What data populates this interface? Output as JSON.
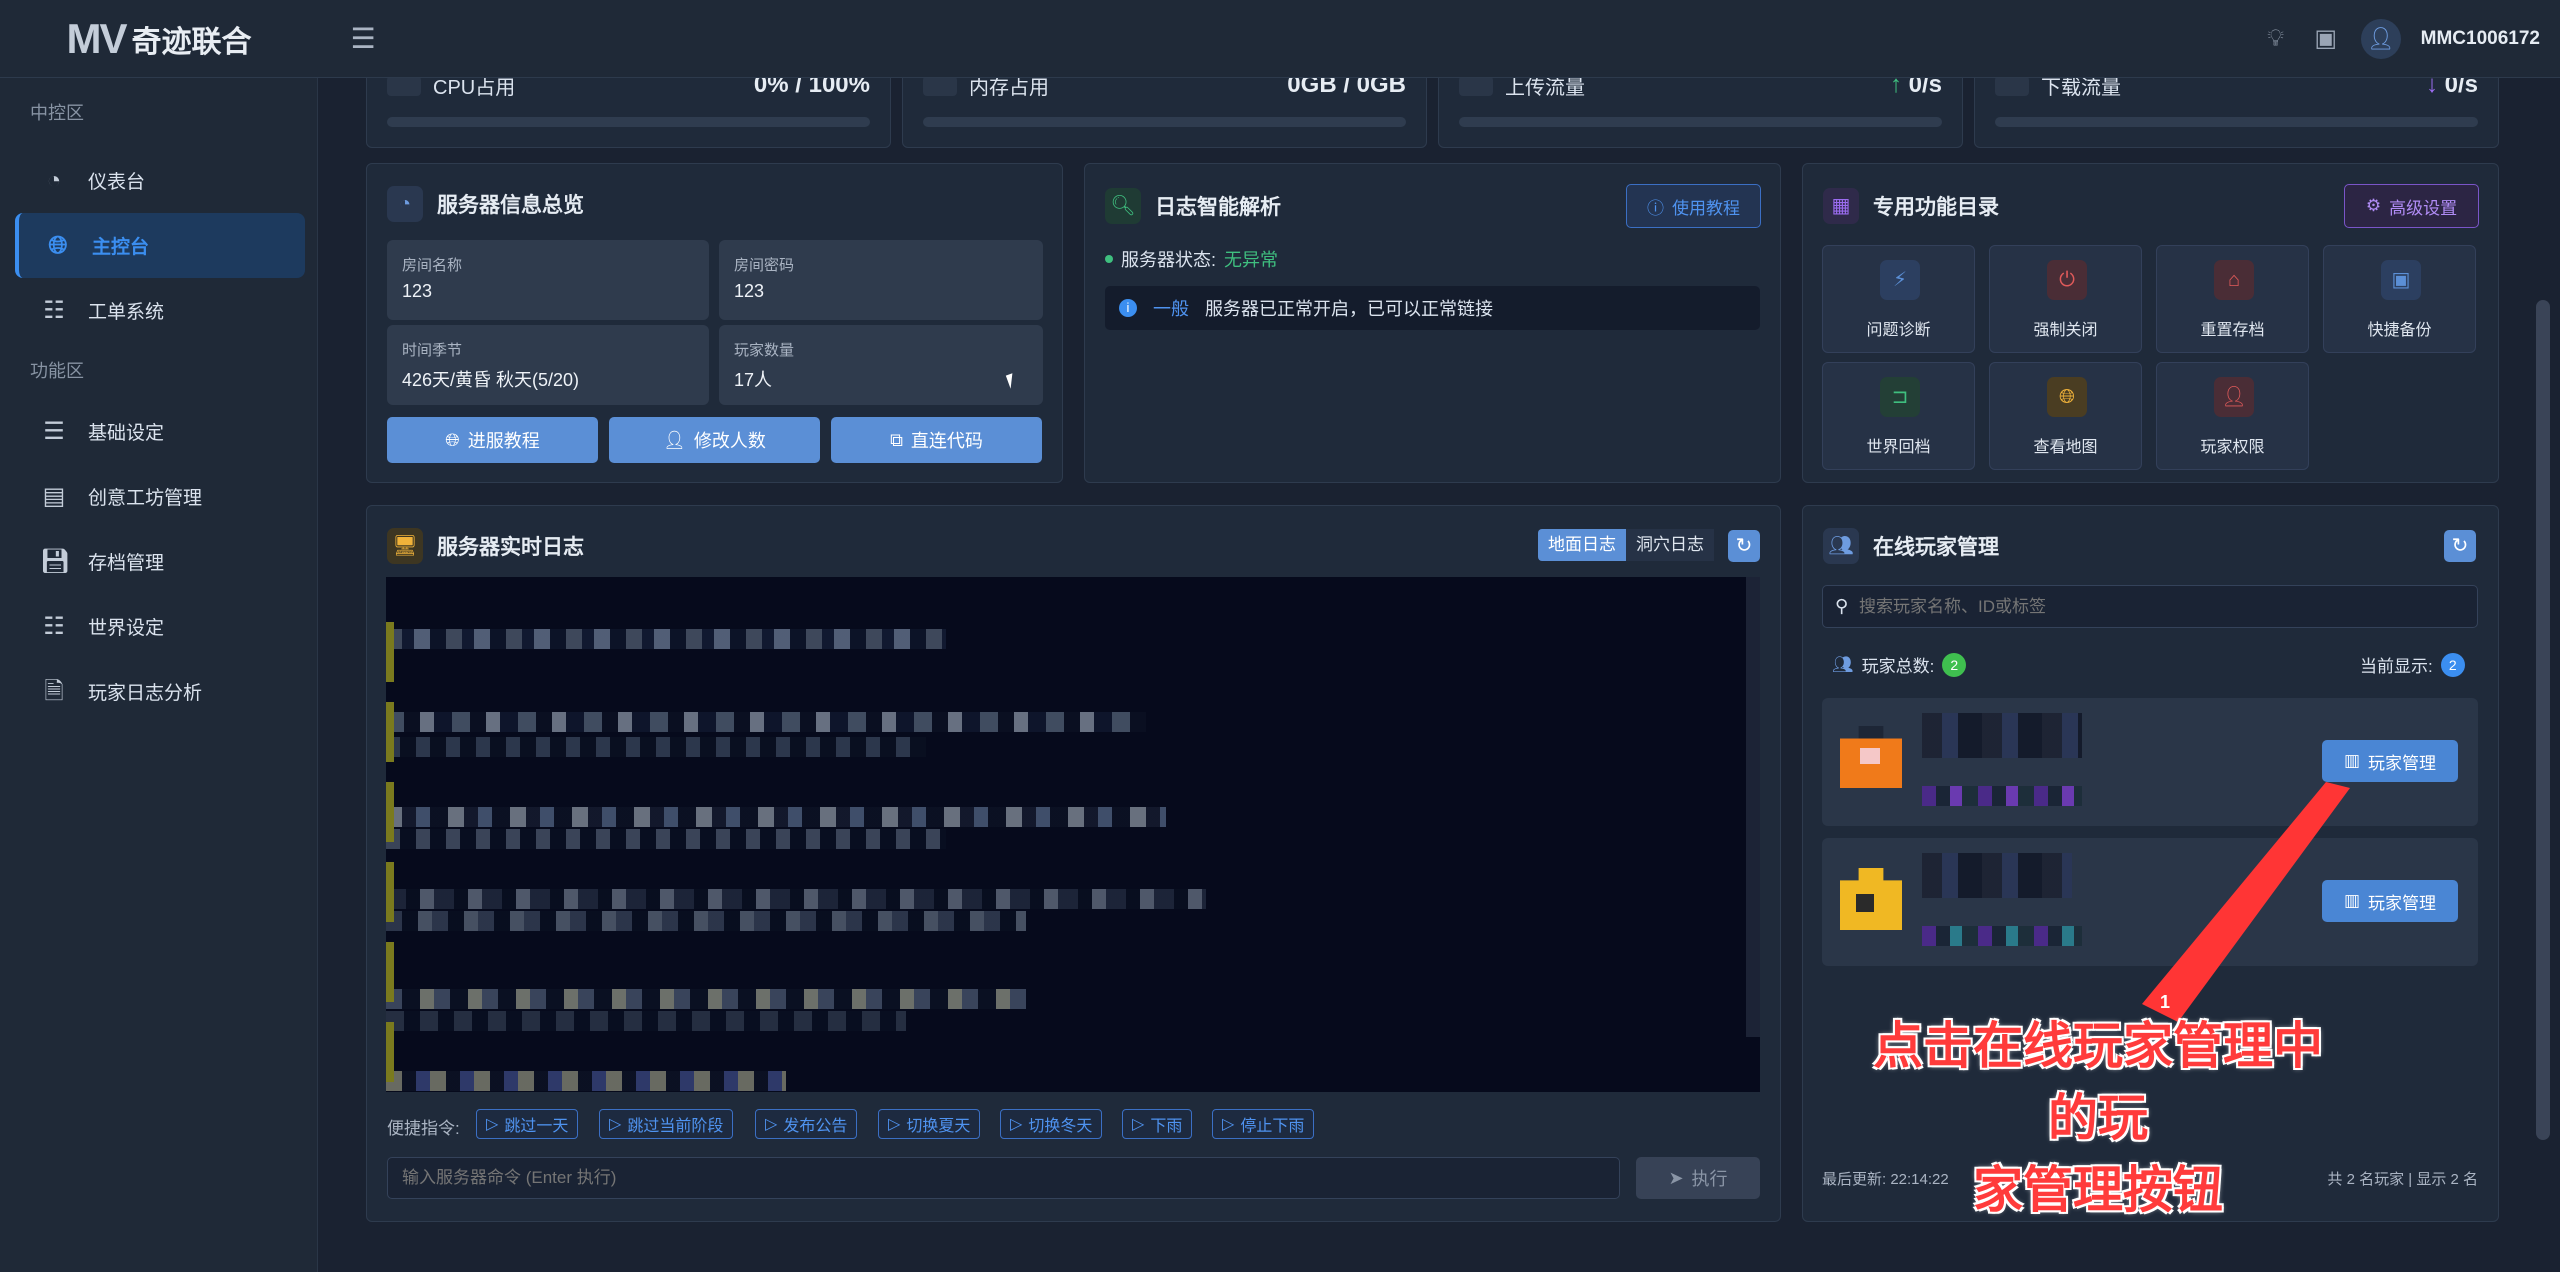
{
  "app": {
    "logo_text": "MV",
    "brand_name": "奇迹联合",
    "username": "MMC1006172"
  },
  "sidebar": {
    "section_control": "中控区",
    "section_function": "功能区",
    "items": [
      {
        "label": "仪表台"
      },
      {
        "label": "主控台"
      },
      {
        "label": "工单系统"
      },
      {
        "label": "基础设定"
      },
      {
        "label": "创意工坊管理"
      },
      {
        "label": "存档管理"
      },
      {
        "label": "世界设定"
      },
      {
        "label": "玩家日志分析"
      }
    ]
  },
  "stats": [
    {
      "label": "CPU占用",
      "value": "0% / 100%",
      "percent": 0
    },
    {
      "label": "内存占用",
      "value": "0GB / 0GB",
      "percent": 0
    },
    {
      "label": "上传流量",
      "value": "0/s",
      "arrow": "↑",
      "percent": 0
    },
    {
      "label": "下载流量",
      "value": "0/s",
      "arrow": "↓",
      "percent": 0
    }
  ],
  "server_info": {
    "title": "服务器信息总览",
    "fields": [
      {
        "key": "房间名称",
        "value": "123"
      },
      {
        "key": "房间密码",
        "value": "123"
      },
      {
        "key": "时间季节",
        "value": "426天/黄昏 秋天(5/20)"
      },
      {
        "key": "玩家数量",
        "value": "17人"
      }
    ],
    "buttons": {
      "join": "进服教程",
      "edit_count": "修改人数",
      "direct_code": "直连代码"
    }
  },
  "log_analysis": {
    "title": "日志智能解析",
    "tutorial_button": "使用教程",
    "status_label": "服务器状态:",
    "status_value": "无异常",
    "entry_level": "一般",
    "entry_text": "服务器已正常开启，已可以正常链接"
  },
  "functions": {
    "title": "专用功能目录",
    "advanced_button": "高级设置",
    "tiles": [
      {
        "label": "问题诊断",
        "icon": "lightning-icon",
        "color": "#5b8fd6"
      },
      {
        "label": "强制关闭",
        "icon": "power-icon",
        "color": "#e05a5a"
      },
      {
        "label": "重置存档",
        "icon": "reset-icon",
        "color": "#e05a5a"
      },
      {
        "label": "快捷备份",
        "icon": "backup-icon",
        "color": "#5b8fd6"
      },
      {
        "label": "世界回档",
        "icon": "rollback-icon",
        "color": "#3fbf7f"
      },
      {
        "label": "查看地图",
        "icon": "globe-icon",
        "color": "#f0b23a"
      },
      {
        "label": "玩家权限",
        "icon": "user-permission-icon",
        "color": "#e05a5a"
      }
    ]
  },
  "realtime_log": {
    "title": "服务器实时日志",
    "tab_ground": "地面日志",
    "tab_cave": "洞穴日志",
    "shortcut_label": "便捷指令:",
    "shortcuts": [
      "跳过一天",
      "跳过当前阶段",
      "发布公告",
      "切换夏天",
      "切换冬天",
      "下雨",
      "停止下雨"
    ],
    "command_placeholder": "输入服务器命令 (Enter 执行)",
    "execute_button": "执行"
  },
  "players": {
    "title": "在线玩家管理",
    "search_placeholder": "搜索玩家名称、ID或标签",
    "total_label": "玩家总数:",
    "total_count": "2",
    "current_label": "当前显示:",
    "current_count": "2",
    "manage_button": "玩家管理",
    "last_update": "最后更新: 22:14:22",
    "footer_summary": "共 2 名玩家 | 显示 2 名"
  },
  "annotation": {
    "step": "1",
    "line1": "点击在线玩家管理中的玩",
    "line2": "家管理按钮"
  },
  "colors": {
    "accent": "#3b8ef0",
    "success": "#3fbf7f",
    "annotation": "#ff3b3b"
  }
}
